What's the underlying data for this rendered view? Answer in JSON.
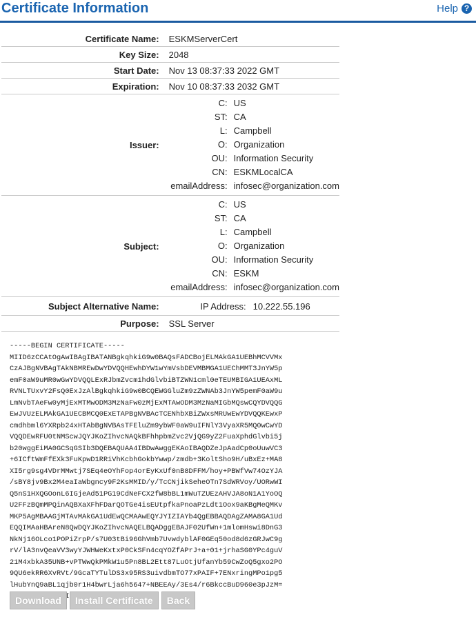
{
  "header": {
    "title": "Certificate Information",
    "help_label": "Help",
    "help_icon": "?"
  },
  "fields": {
    "name": {
      "label": "Certificate Name:",
      "value": "ESKMServerCert"
    },
    "key_size": {
      "label": "Key Size:",
      "value": "2048"
    },
    "start": {
      "label": "Start Date:",
      "value": "Nov 13 08:37:33 2022 GMT"
    },
    "expiration": {
      "label": "Expiration:",
      "value": "Nov 10 08:37:33 2032 GMT"
    },
    "issuer": {
      "label": "Issuer:",
      "rows": [
        {
          "k": "C:",
          "v": "US"
        },
        {
          "k": "ST:",
          "v": "CA"
        },
        {
          "k": "L:",
          "v": "Campbell"
        },
        {
          "k": "O:",
          "v": "Organization"
        },
        {
          "k": "OU:",
          "v": "Information Security"
        },
        {
          "k": "CN:",
          "v": "ESKMLocalCA"
        },
        {
          "k": "emailAddress:",
          "v": "infosec@organization.com"
        }
      ]
    },
    "subject": {
      "label": "Subject:",
      "rows": [
        {
          "k": "C:",
          "v": "US"
        },
        {
          "k": "ST:",
          "v": "CA"
        },
        {
          "k": "L:",
          "v": "Campbell"
        },
        {
          "k": "O:",
          "v": "Organization"
        },
        {
          "k": "OU:",
          "v": "Information Security"
        },
        {
          "k": "CN:",
          "v": "ESKM"
        },
        {
          "k": "emailAddress:",
          "v": "infosec@organization.com"
        }
      ]
    },
    "san": {
      "label": "Subject Alternative Name:",
      "key": "IP Address:",
      "value": "10.222.55.196"
    },
    "purpose": {
      "label": "Purpose:",
      "value": "SSL Server"
    }
  },
  "certificate_pem": "-----BEGIN CERTIFICATE-----\nMIID6zCCAtOgAwIBAgIBATANBgkqhkiG9w0BAQsFADCBojELMAkGA1UEBhMCVVMx\nCzAJBgNVBAgTAkNBMREwDwYDVQQHEwhDYW1wYmVsbDEVMBMGA1UEChMMT3JnYW5p\nemF0aW9uMR0wGwYDVQQLExRJbmZvcm1hdGlvbiBTZWN1cml0eTEUMBIGA1UEAxML\nRVNLTUxvY2FsQ0ExJzAlBgkqhkiG9w0BCQEWGGluZm9zZWNAb3JnYW5pemF0aW9u\nLmNvbTAeFw0yMjExMTMwODM3MzNaFw0zMjExMTAwODM3MzNaMIGbMQswCQYDVQQG\nEwJVUzELMAkGA1UECBMCQ0ExETAPBgNVBAcTCENhbXBiZWxsMRUwEwYDVQQKEwxP\ncmdhbml6YXRpb24xHTAbBgNVBAsTFEluZm9ybWF0aW9uIFNlY3VyaXR5MQ0wCwYD\nVQQDEwRFU0tNMScwJQYJKoZIhvcNAQkBFhhpbmZvc2VjQG9yZ2FuaXphdGlvbi5j\nb20wggEiMA0GCSqGSIb3DQEBAQUAA4IBDwAwggEKAoIBAQDZeJpAadCp0oUuwVC3\n+6ICftWmFfEXk3FuKpwD1RRiVhKcbhGokbYwwp/zmdb+3KoltSho9H/uBxEz+MA8\nXI5rg9sg4VDrMMwtj7SEq4eOYhFop4orEyKxUf0nB8DFFM/hoy+PBWfVw74OzYJA\n/sBY8jv9Bx2M4eaIaWbgncy9F2KsMMID/y/TcCNjikSeheOTn7SdWRVoy/UORwWI\nQ5nS1HXQGOonL6IGjeAd51PG19CdNeFCX2fW8bBL1mWuTZUEzAHVJA8oN1A1YoOQ\nU2FFzBQmMPQinAQBXaXFhFDarQOTGe4isEUtpfkaPnoaPzLdt1Oox9aKBgMeQMKv\nMKP5AgMBAAGjMTAvMAkGA1UdEwQCMAAwEQYJYIZIAYb4QgEBBAQDAgZAMA8GA1Ud\nEQQIMAaHBAreN8QwDQYJKoZIhvcNAQELBQADggEBAJF02UfWn+1mlomHswi8DnG3\nNkNj16OLco1POPiZrpP/s7U03tBi96GhVmb7UvwdyblAF0GEq50od8d6zGRJwC9g\nrV/lA3nvQeaVV3wyYJWHWeKxtxP0CkSFn4cqYOZfAPrJ+a+01+jrhaSG0YPc4guV\n21M4xbkA35UNB+vPTWwQkPMkW1u5Pn8BL2Ett87LuOtjUfanYb59CwZoQ5gxo2PO\n9QU6ekRR6XvRVt/9GcaTYTulDS3x95RS3uivdbmTO77xPAIF+7ENxringMPo1pg5\nlHubYnQ9aBL1qjb0r1H4bwrLja6h5647+NBEEAy/3Es4/r6BkccBuD960e3pJzM=\n-----END CERTIFICATE-----",
  "buttons": {
    "download": "Download",
    "install": "Install Certificate",
    "back": "Back"
  },
  "colors": {
    "accent": "#1a64b0",
    "button_disabled": "#c8c8c8"
  }
}
